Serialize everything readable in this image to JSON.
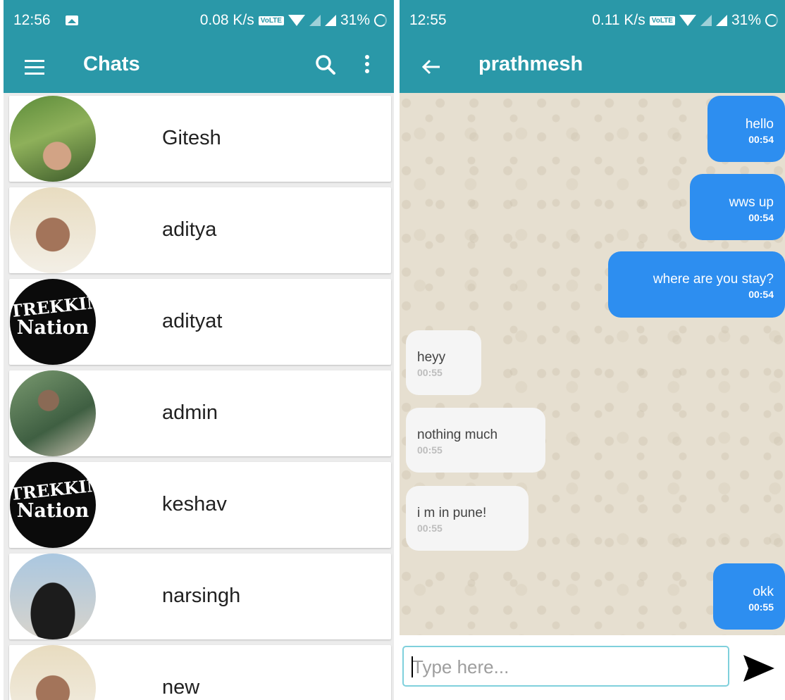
{
  "left": {
    "status": {
      "time": "12:56",
      "speed": "0.08 K/s",
      "volte": "VoLTE",
      "battery": "31%"
    },
    "appbar": {
      "title": "Chats"
    },
    "chats": [
      {
        "name": "Gitesh",
        "avatar": "photo"
      },
      {
        "name": "aditya",
        "avatar": "photo"
      },
      {
        "name": "adityat",
        "avatar": "trekking-nation-logo"
      },
      {
        "name": "admin",
        "avatar": "photo"
      },
      {
        "name": "keshav",
        "avatar": "trekking-nation-logo"
      },
      {
        "name": "narsingh",
        "avatar": "car-photo"
      },
      {
        "name": "new",
        "avatar": "photo"
      }
    ],
    "logo_text": {
      "line1": "TREKKING",
      "line2": "Nation"
    }
  },
  "right": {
    "status": {
      "time": "12:55",
      "speed": "0.11 K/s",
      "volte": "VoLTE",
      "battery": "31%"
    },
    "appbar": {
      "title": "prathmesh"
    },
    "messages": [
      {
        "text": "hello",
        "time": "00:54",
        "dir": "out"
      },
      {
        "text": "wws up",
        "time": "00:54",
        "dir": "out"
      },
      {
        "text": "where are you stay?",
        "time": "00:54",
        "dir": "out"
      },
      {
        "text": "heyy",
        "time": "00:55",
        "dir": "in"
      },
      {
        "text": "nothing much",
        "time": "00:55",
        "dir": "in"
      },
      {
        "text": "i m in pune!",
        "time": "00:55",
        "dir": "in"
      },
      {
        "text": "okk",
        "time": "00:55",
        "dir": "out"
      }
    ],
    "composer": {
      "placeholder": "Type here..."
    }
  },
  "colors": {
    "primary": "#2a98a8",
    "outgoing": "#2d8ef0",
    "incoming": "#f5f5f5",
    "chat_bg": "#e6dfd0"
  },
  "icons": [
    "menu-icon",
    "search-icon",
    "more-vert-icon",
    "back-arrow-icon",
    "send-icon",
    "gallery-icon",
    "wifi-icon",
    "signal-icon",
    "battery-icon"
  ]
}
